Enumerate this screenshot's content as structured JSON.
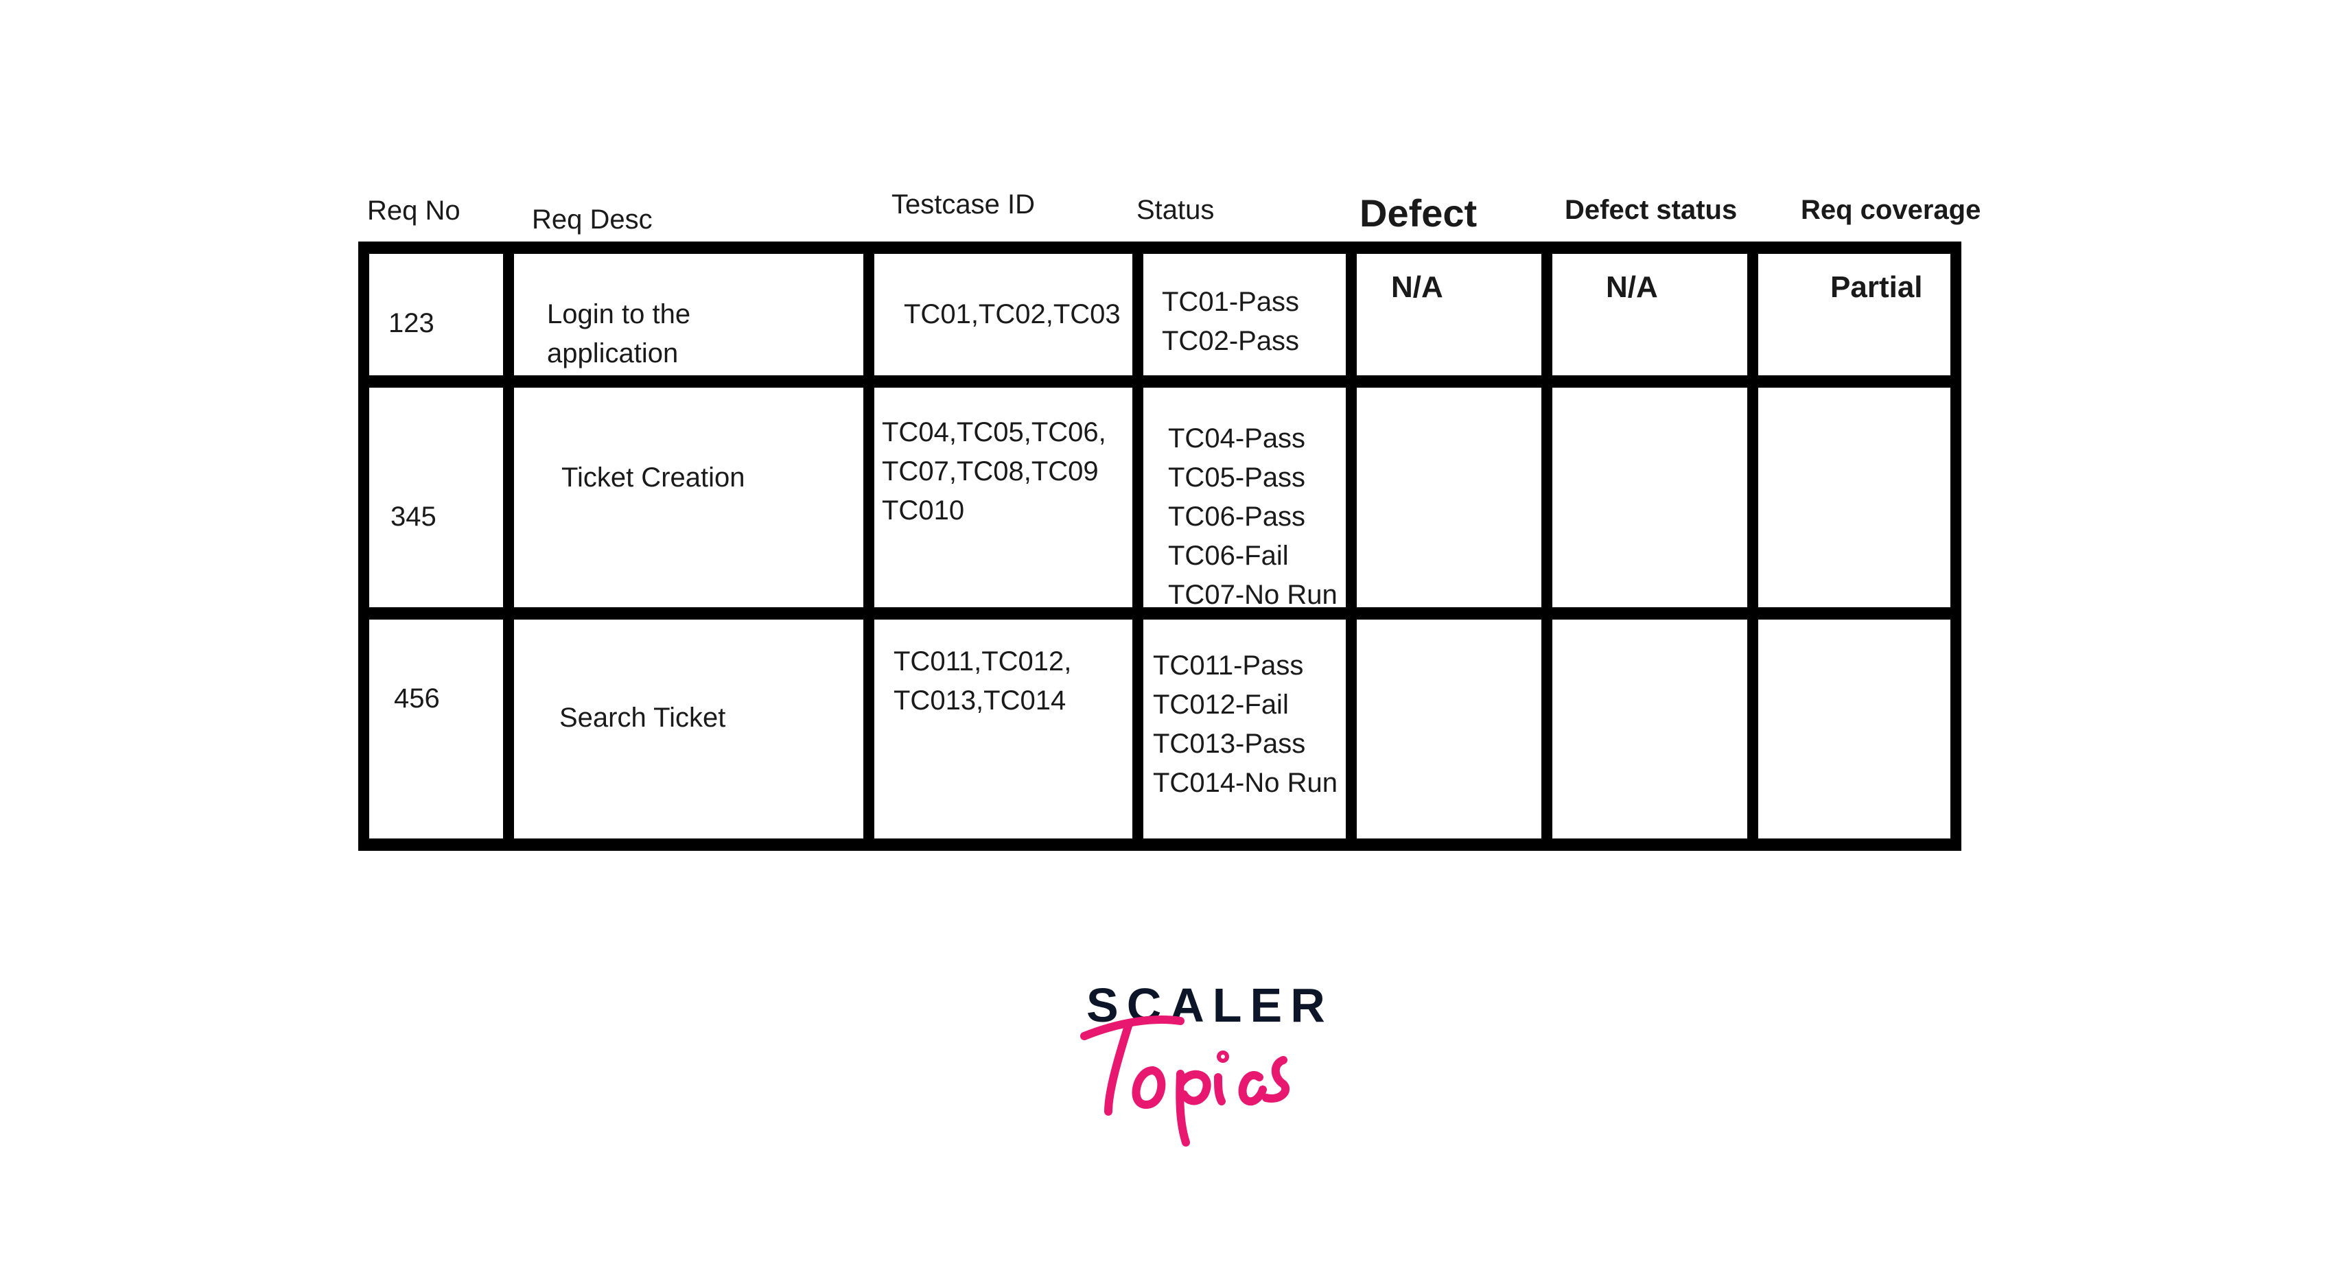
{
  "headers": [
    "Req No",
    "Req Desc",
    "Testcase ID",
    "Status",
    "Defect",
    "Defect status",
    "Req coverage"
  ],
  "rows": [
    {
      "req_no": "123",
      "req_desc": [
        "Login to the",
        "application"
      ],
      "testcase_ids": [
        "TC01,TC02,TC03"
      ],
      "status": [
        "TC01-Pass",
        "TC02-Pass"
      ],
      "defect": "N/A",
      "defect_status": "N/A",
      "req_coverage": "Partial"
    },
    {
      "req_no": "345",
      "req_desc": [
        "Ticket Creation"
      ],
      "testcase_ids": [
        "TC04,TC05,TC06,",
        "TC07,TC08,TC09",
        "TC010"
      ],
      "status": [
        "TC04-Pass",
        "TC05-Pass",
        "TC06-Pass",
        "TC06-Fail",
        "TC07-No Run"
      ],
      "defect": "",
      "defect_status": "",
      "req_coverage": ""
    },
    {
      "req_no": "456",
      "req_desc": [
        "Search Ticket"
      ],
      "testcase_ids": [
        "TC011,TC012,",
        "TC013,TC014"
      ],
      "status": [
        "TC011-Pass",
        "TC012-Fail",
        "TC013-Pass",
        "TC014-No Run"
      ],
      "defect": "",
      "defect_status": "",
      "req_coverage": ""
    }
  ],
  "logo": {
    "brand": "SCALER",
    "sub": "Topics",
    "colors": {
      "brand": "#0d1628",
      "sub": "#e8176f"
    }
  }
}
